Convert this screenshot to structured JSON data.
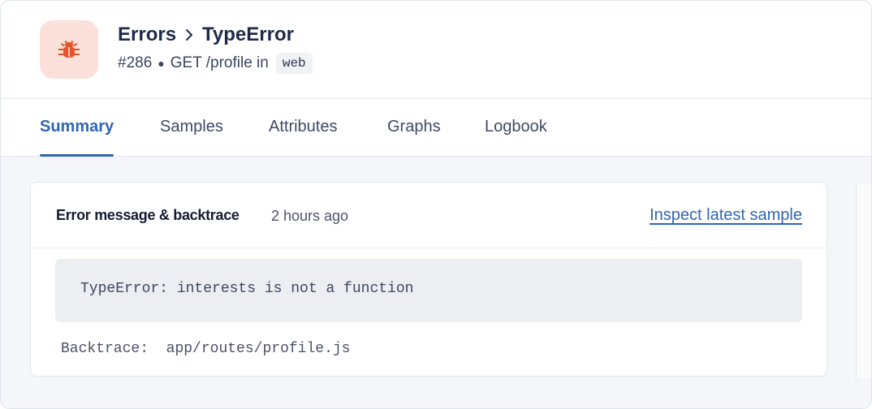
{
  "header": {
    "icon": "bug-icon",
    "icon_color": "#e5532b",
    "icon_bg": "#fbe1d9",
    "breadcrumb": [
      "Errors",
      "TypeError"
    ],
    "incident_number": "#286",
    "action": "GET /profile in",
    "environment": "web"
  },
  "tabs": [
    {
      "label": "Summary",
      "active": true
    },
    {
      "label": "Samples",
      "active": false
    },
    {
      "label": "Attributes",
      "active": false
    },
    {
      "label": "Graphs",
      "active": false
    },
    {
      "label": "Logbook",
      "active": false
    }
  ],
  "card": {
    "title": "Error message & backtrace",
    "time": "2 hours ago",
    "link_label": "Inspect latest sample",
    "error_message": "TypeError: interests is not a function",
    "backtrace_label": "Backtrace:",
    "backtrace_path": "app/routes/profile.js"
  },
  "colors": {
    "accent": "#2f66b3",
    "title": "#1e2a48"
  }
}
